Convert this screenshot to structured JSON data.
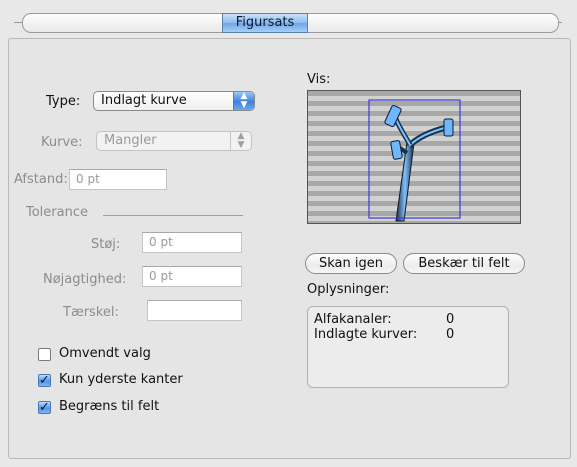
{
  "tab": {
    "selected": "Figursats"
  },
  "type": {
    "label": "Type:",
    "value": "Indlagt kurve"
  },
  "kurve": {
    "label": "Kurve:",
    "value": "Mangler"
  },
  "afstand": {
    "label": "Afstand:",
    "value": "0 pt"
  },
  "tolerance": {
    "title": "Tolerance",
    "stoj": {
      "label": "Støj:",
      "value": "0 pt"
    },
    "nojagtighed": {
      "label": "Nøjagtighed:",
      "value": "0 pt"
    },
    "taerskel": {
      "label": "Tærskel:",
      "value": ""
    }
  },
  "checks": [
    {
      "label": "Omvendt valg",
      "checked": false
    },
    {
      "label": "Kun yderste kanter",
      "checked": true
    },
    {
      "label": "Begræns til felt",
      "checked": true
    }
  ],
  "preview": {
    "label": "Vis:"
  },
  "buttons": {
    "rescan": "Skan igen",
    "crop": "Beskær til felt"
  },
  "info": {
    "title": "Oplysninger:",
    "rows": [
      {
        "label": "Alfakanaler:",
        "value": "0"
      },
      {
        "label": "Indlagte kurver:",
        "value": "0"
      }
    ]
  },
  "colors": {
    "accent": "#3a82df",
    "frame": "#3b3bd6",
    "image_tint": "#6fb6ff"
  }
}
